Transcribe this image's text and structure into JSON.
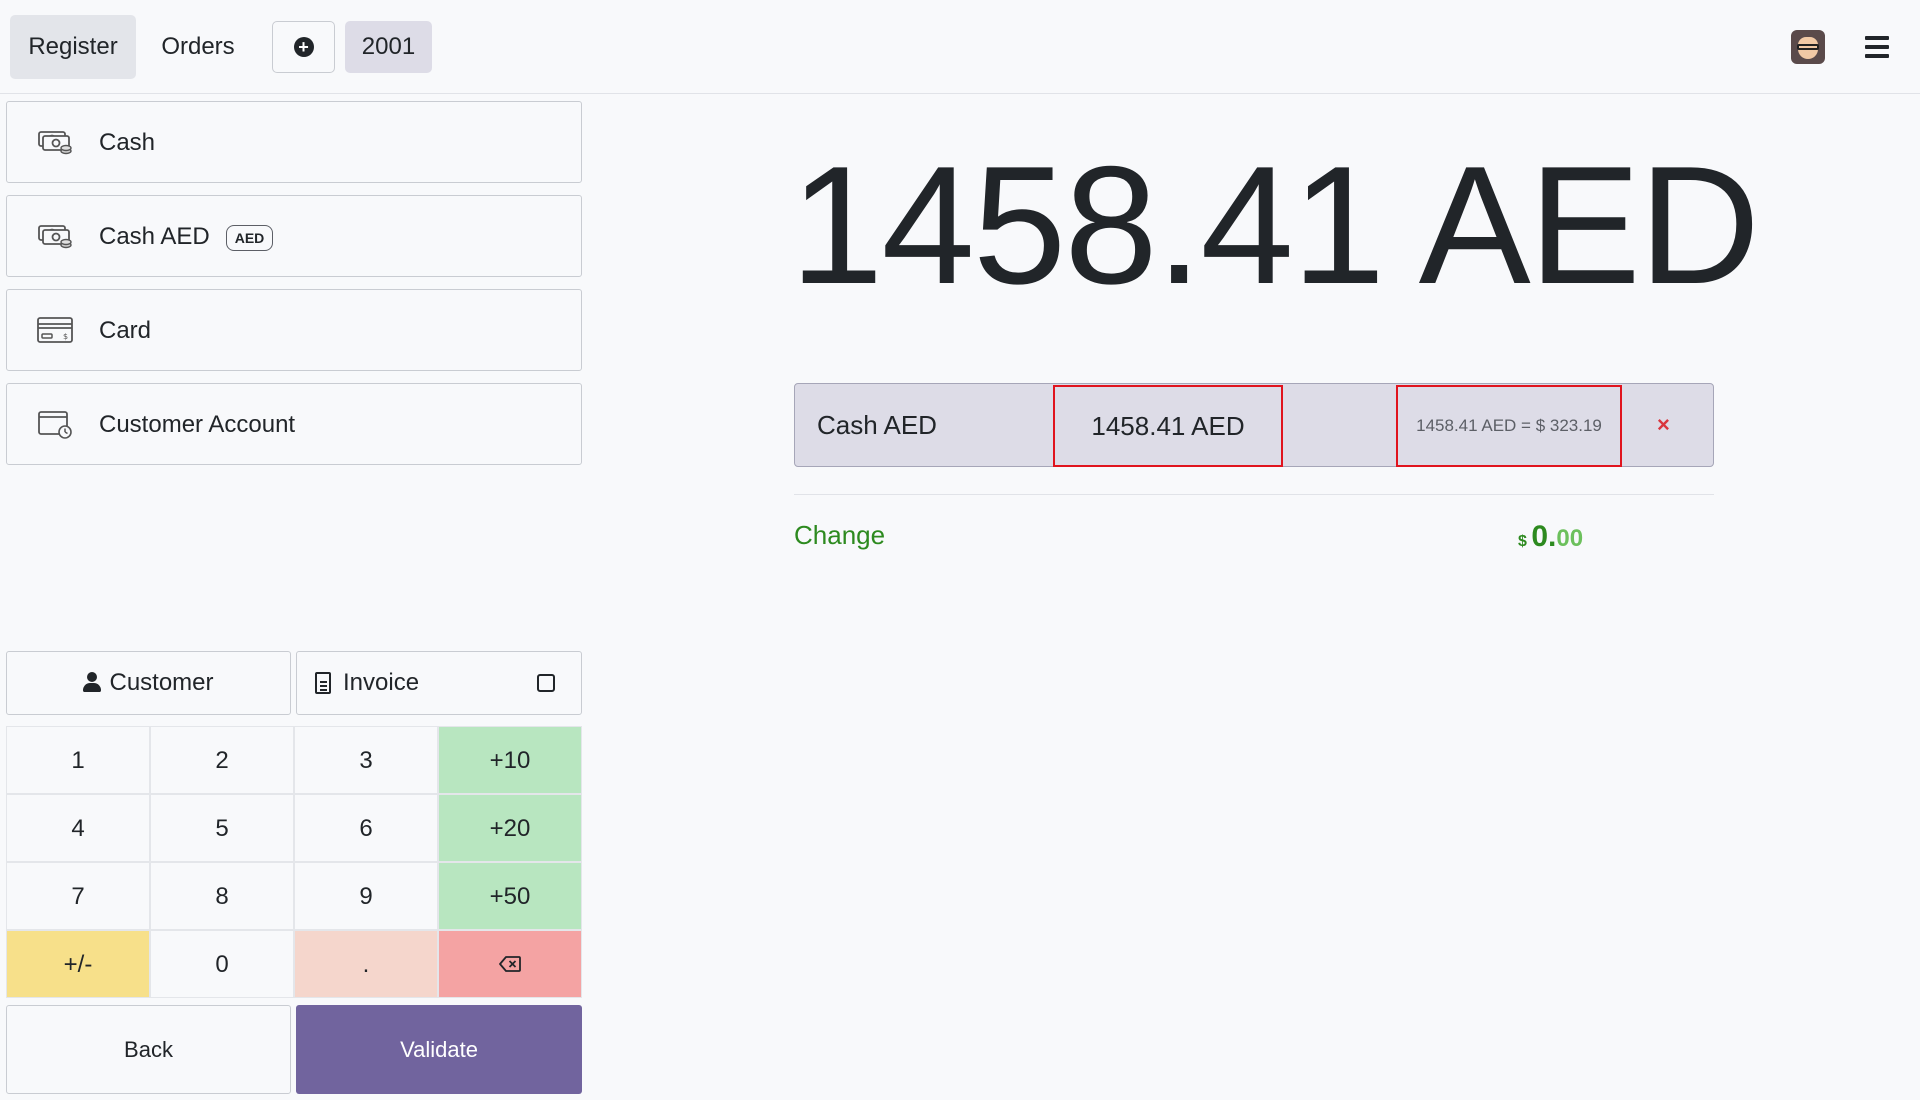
{
  "topbar": {
    "register": "Register",
    "orders": "Orders",
    "order_number": "2001"
  },
  "payment_methods": [
    {
      "label": "Cash",
      "icon": "cash-icon"
    },
    {
      "label": "Cash AED",
      "badge": "AED",
      "icon": "cash-icon"
    },
    {
      "label": "Card",
      "icon": "card-icon"
    },
    {
      "label": "Customer Account",
      "icon": "customer-account-icon"
    }
  ],
  "actions": {
    "customer": "Customer",
    "invoice": "Invoice"
  },
  "numpad": {
    "keys": [
      "1",
      "2",
      "3",
      "+10",
      "4",
      "5",
      "6",
      "+20",
      "7",
      "8",
      "9",
      "+50",
      "+/-",
      "0",
      "."
    ]
  },
  "footer": {
    "back": "Back",
    "validate": "Validate"
  },
  "summary": {
    "total": "1458.41 AED",
    "payment_line": {
      "name": "Cash AED",
      "amount": "1458.41 AED",
      "conversion": "1458.41 AED = $ 323.19",
      "delete": "×"
    },
    "change_label": "Change",
    "change_currency": "$",
    "change_integer": "0.",
    "change_decimals": "00"
  },
  "colors": {
    "validate": "#71649e",
    "green_key": "#b8e6c0",
    "yellow_key": "#f7e08a",
    "peach_key": "#f5d6cc",
    "red_key": "#f4a3a3",
    "change_green": "#2d8a1f",
    "highlight_red": "#e0141e"
  }
}
